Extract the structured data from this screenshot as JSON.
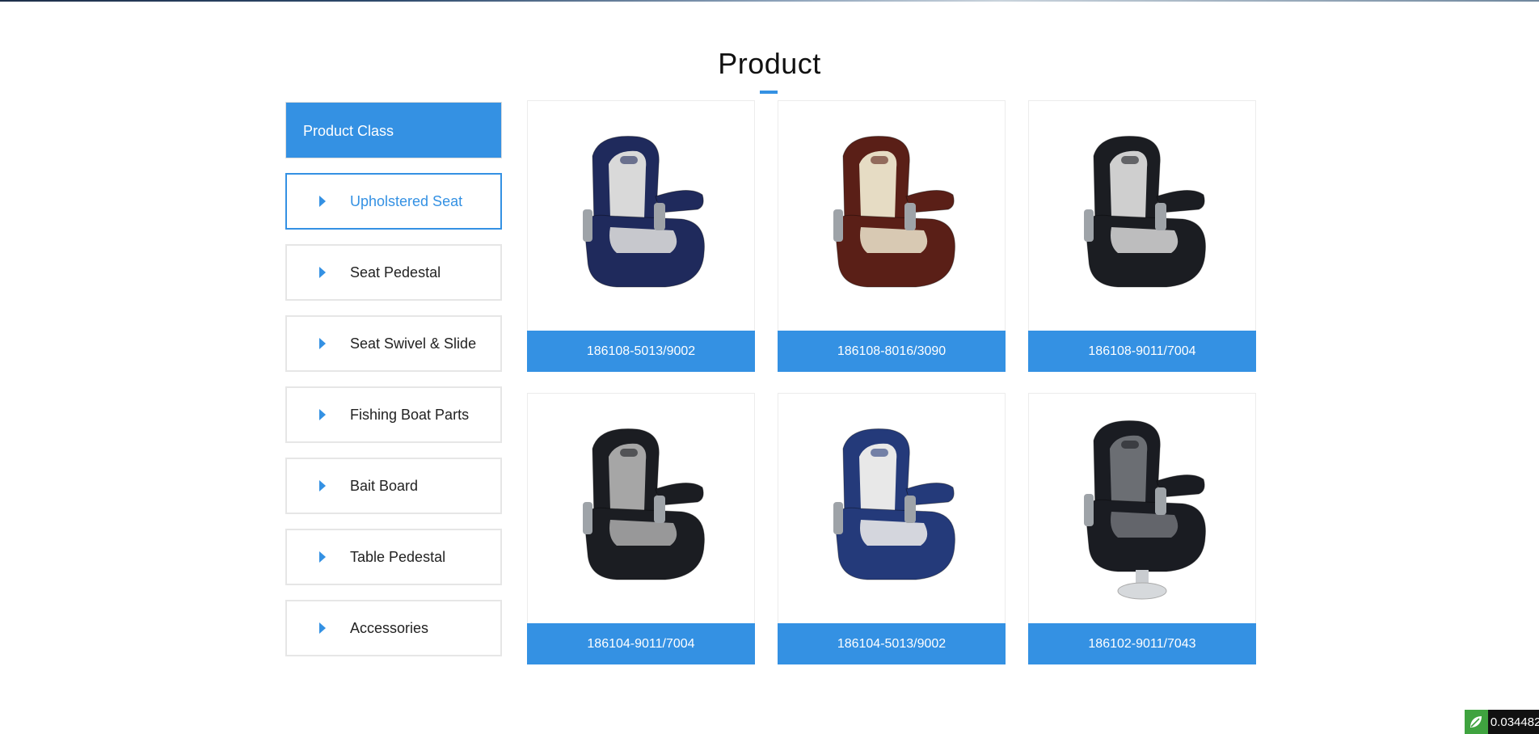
{
  "page": {
    "title": "Product"
  },
  "sidebar": {
    "header": "Product Class",
    "items": [
      {
        "label": "Upholstered Seat",
        "active": true
      },
      {
        "label": "Seat Pedestal"
      },
      {
        "label": "Seat Swivel & Slide"
      },
      {
        "label": "Fishing Boat Parts"
      },
      {
        "label": "Bait Board"
      },
      {
        "label": "Table Pedestal"
      },
      {
        "label": "Accessories"
      }
    ]
  },
  "products": [
    {
      "code": "186108-5013/9002",
      "color": "#1f2a5c",
      "insert": "#d9d9d9"
    },
    {
      "code": "186108-8016/3090",
      "color": "#5a1f17",
      "insert": "#e6dcc4"
    },
    {
      "code": "186108-9011/7004",
      "color": "#1b1d22",
      "insert": "#cfcfcf"
    },
    {
      "code": "186104-9011/7004",
      "color": "#1b1d22",
      "insert": "#a6a6a6"
    },
    {
      "code": "186104-5013/9002",
      "color": "#243a7a",
      "insert": "#e8e8e8"
    },
    {
      "code": "186102-9011/7043",
      "color": "#1a1c22",
      "insert": "#6b6e73"
    }
  ],
  "colors": {
    "accent": "#3491e3"
  },
  "badge": {
    "value": "0.034482",
    "icon": "leaf-icon"
  }
}
